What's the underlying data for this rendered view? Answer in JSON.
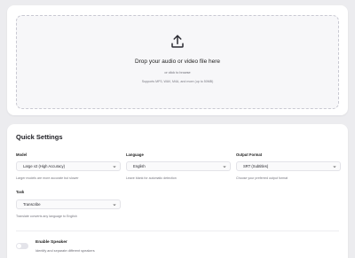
{
  "upload": {
    "title": "Drop your audio or video file here",
    "subtitle": "or click to browse",
    "formats": "Supports MP3, WAV, M4A, and more (up to 50MB)"
  },
  "settings": {
    "title": "Quick Settings",
    "model": {
      "label": "Model",
      "value": "Large v2 (High Accuracy)",
      "hint": "Larger models are more accurate but slower"
    },
    "language": {
      "label": "Language",
      "value": "English",
      "hint": "Leave blank for automatic detection"
    },
    "output_format": {
      "label": "Output Format",
      "value": "SRT (Subtitles)",
      "hint": "Choose your preferred output format"
    },
    "task": {
      "label": "Task",
      "value": "Transcribe",
      "hint": "Translate converts any language to English"
    },
    "speaker": {
      "label": "Enable Speaker",
      "description": "Identify and separate different speakers",
      "enabled": false
    }
  },
  "colors": {
    "background": "#ececef",
    "card": "#ffffff",
    "dropzone": "#f7f7f9",
    "toggle_off": "#e4e4ea"
  }
}
